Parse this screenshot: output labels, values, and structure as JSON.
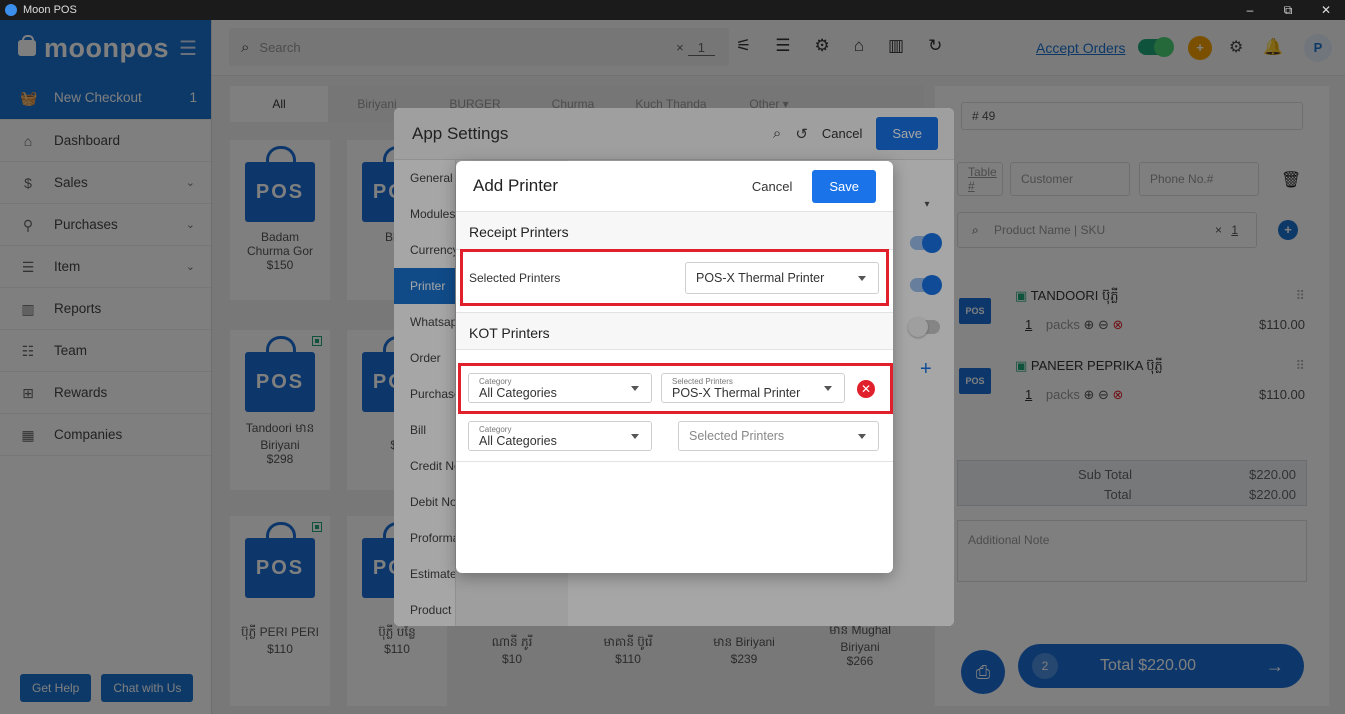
{
  "window": {
    "title": "Moon POS",
    "minimize": "–",
    "maximize": "⧉",
    "close": "✕"
  },
  "sidebar": {
    "logo": "moonpos",
    "items": [
      {
        "label": "New Checkout",
        "badge": "1",
        "icon": "basket-icon"
      },
      {
        "label": "Dashboard",
        "icon": "home-icon"
      },
      {
        "label": "Sales",
        "icon": "dollar-icon"
      },
      {
        "label": "Purchases",
        "icon": "purchase-bag-icon"
      },
      {
        "label": "Item",
        "icon": "item-list-icon"
      },
      {
        "label": "Reports",
        "icon": "reports-icon"
      },
      {
        "label": "Team",
        "icon": "team-icon"
      },
      {
        "label": "Rewards",
        "icon": "gift-icon"
      },
      {
        "label": "Companies",
        "icon": "building-icon"
      }
    ],
    "help": "Get Help",
    "chat": "Chat with Us"
  },
  "topbar": {
    "search_placeholder": "Search",
    "qty_x": "×",
    "qty": "1",
    "accept_orders": "Accept Orders",
    "avatar": "P"
  },
  "categories": [
    "All",
    "Biriyani",
    "BURGER",
    "Churma",
    "Kuch Thanda",
    "Other ▾"
  ],
  "products": [
    {
      "name": "Badam\nChurma Gor",
      "price": "$150"
    },
    {
      "name": "Blue",
      "price": "$"
    },
    {
      "name": "Tandoori មាន\nBiriyani",
      "price": "$298"
    },
    {
      "name": "គុ",
      "price": "$1"
    },
    {
      "name": "ប៊ុភ្លី PERI PERI",
      "price": "$110"
    },
    {
      "name": "ប៊ុភ្លី បន្លែ",
      "price": "$110"
    },
    {
      "name": "ណានី ភូរី",
      "price": "$10"
    },
    {
      "name": "មាគានី ប៊ូរើ",
      "price": "$110"
    },
    {
      "name": "មាន Biriyani",
      "price": "$239"
    },
    {
      "name": "មាន Mughal\nBiriyani",
      "price": "$266"
    }
  ],
  "pos_badge": "POS",
  "order": {
    "number": "# 49",
    "table": "Table #",
    "customer": "Customer",
    "phone": "Phone No.#",
    "product_search": "Product Name | SKU",
    "qty": "1",
    "items": [
      {
        "name": "TANDOORI ប៊ុភ្លី",
        "qty": "1",
        "unit": "packs",
        "price": "$110.00"
      },
      {
        "name": "PANEER PEPRIKA ប៊ុភ្លី",
        "qty": "1",
        "unit": "packs",
        "price": "$110.00"
      }
    ],
    "subtotal_label": "Sub Total",
    "subtotal": "$220.00",
    "total_label": "Total",
    "total": "$220.00",
    "note_placeholder": "Additional Note",
    "cart_count": "2",
    "total_button": "Total $220.00"
  },
  "settings": {
    "title": "App Settings",
    "cancel": "Cancel",
    "save": "Save",
    "menu": [
      "General",
      "Modules",
      "Currency",
      "Printer",
      "Whatsapp",
      "Order",
      "Purchase",
      "Bill",
      "Credit Note",
      "Debit Note",
      "Proforma",
      "Estimate",
      "Product"
    ]
  },
  "add_printer": {
    "title": "Add Printer",
    "cancel": "Cancel",
    "save": "Save",
    "receipt_section": "Receipt Printers",
    "selected_printers_label": "Selected Printers",
    "receipt_printer": "POS-X Thermal Printer",
    "kot_section": "KOT Printers",
    "category_label": "Category",
    "selected_printers_field_label": "Selected Printers",
    "kot_rows": [
      {
        "category": "All Categories",
        "printer": "POS-X Thermal Printer"
      },
      {
        "category": "All Categories",
        "printer": "Selected Printers"
      }
    ]
  }
}
